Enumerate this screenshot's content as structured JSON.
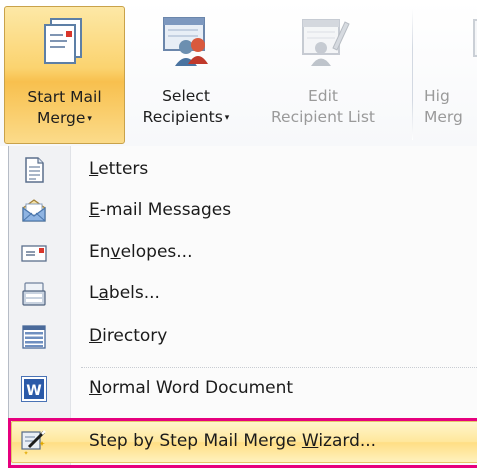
{
  "ribbon": {
    "start_mail_merge": {
      "line1": "Start Mail",
      "line2": "Merge",
      "caret": "▾",
      "icon": "start-mail-merge-icon",
      "active": true
    },
    "select_recipients": {
      "line1": "Select",
      "line2": "Recipients",
      "caret": "▾",
      "icon": "select-recipients-icon"
    },
    "edit_recipient_list": {
      "line1": "Edit",
      "line2": "Recipient List",
      "icon": "edit-recipient-list-icon",
      "disabled": true
    },
    "highlight_merge_fields": {
      "line1": "Hig",
      "line2": "Merg",
      "icon": "highlight-merge-fields-icon",
      "disabled": true
    }
  },
  "menu": {
    "items": [
      {
        "pre": "",
        "ul": "L",
        "post": "etters",
        "icon": "letters-icon"
      },
      {
        "pre": "",
        "ul": "E",
        "post": "-mail Messages",
        "icon": "email-icon"
      },
      {
        "pre": "En",
        "ul": "v",
        "post": "elopes...",
        "icon": "envelope-icon"
      },
      {
        "pre": "L",
        "ul": "a",
        "post": "bels...",
        "icon": "labels-icon"
      },
      {
        "pre": "",
        "ul": "D",
        "post": "irectory",
        "icon": "directory-icon"
      },
      {
        "pre": "",
        "ul": "N",
        "post": "ormal Word Document",
        "icon": "word-document-icon"
      }
    ],
    "wizard": {
      "pre": "Step by Step Mail Merge ",
      "ul": "W",
      "post": "izard...",
      "icon": "wizard-icon",
      "highlighted": true
    }
  },
  "colors": {
    "active_button": "#f8c04e",
    "menu_highlight": "#ffe79b",
    "annotation_outline": "#e6007e"
  }
}
